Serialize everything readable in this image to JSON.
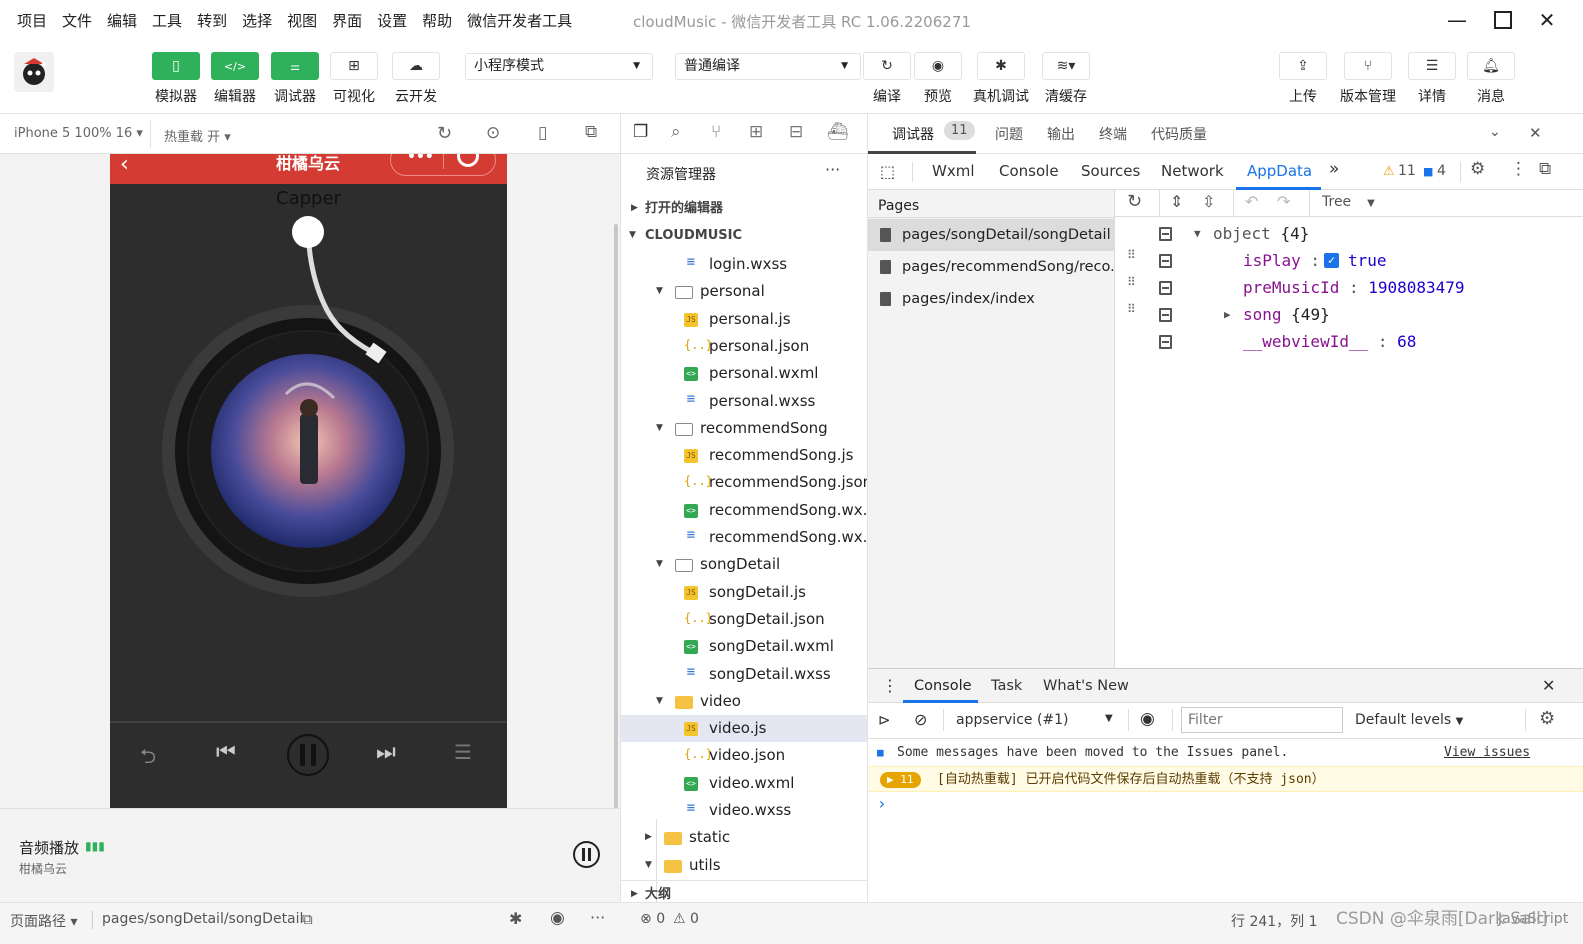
{
  "menu": [
    "项目",
    "文件",
    "编辑",
    "工具",
    "转到",
    "选择",
    "视图",
    "界面",
    "设置",
    "帮助",
    "微信开发者工具"
  ],
  "window_title": "cloudMusic - 微信开发者工具 RC 1.06.2206271",
  "toolbar": {
    "simulator": "模拟器",
    "editor": "编辑器",
    "debugger": "调试器",
    "visual": "可视化",
    "cloud": "云开发",
    "mode_select": "小程序模式",
    "compile_select": "普通编译",
    "compile": "编译",
    "preview": "预览",
    "real_debug": "真机调试",
    "clear_cache": "清缓存",
    "upload": "上传",
    "version": "版本管理",
    "details": "详情",
    "messages": "消息"
  },
  "simbar": {
    "device": "iPhone 5 100% 16",
    "hot_reload": "热重载 开"
  },
  "phone": {
    "nav_title": "柑橘乌云",
    "artist": "Capper"
  },
  "bgm": {
    "title": "音频播放",
    "subtitle": "柑橘乌云"
  },
  "statusL": {
    "path_label": "页面路径",
    "path": "pages/songDetail/songDetail"
  },
  "explorer": {
    "title": "资源管理器",
    "open_editors": "打开的编辑器",
    "project": "CLOUDMUSIC",
    "outline": "大纲",
    "files": [
      {
        "name": "login.wxss",
        "type": "wxss",
        "depth": 2
      },
      {
        "name": "personal",
        "type": "folder",
        "depth": 1,
        "open": true
      },
      {
        "name": "personal.js",
        "type": "js",
        "depth": 2
      },
      {
        "name": "personal.json",
        "type": "json",
        "depth": 2
      },
      {
        "name": "personal.wxml",
        "type": "wxml",
        "depth": 2
      },
      {
        "name": "personal.wxss",
        "type": "wxss",
        "depth": 2
      },
      {
        "name": "recommendSong",
        "type": "folder",
        "depth": 1,
        "open": true
      },
      {
        "name": "recommendSong.js",
        "type": "js",
        "depth": 2
      },
      {
        "name": "recommendSong.json",
        "type": "json",
        "depth": 2
      },
      {
        "name": "recommendSong.wx...",
        "type": "wxml",
        "depth": 2
      },
      {
        "name": "recommendSong.wx...",
        "type": "wxss",
        "depth": 2
      },
      {
        "name": "songDetail",
        "type": "folder",
        "depth": 1,
        "open": true
      },
      {
        "name": "songDetail.js",
        "type": "js",
        "depth": 2
      },
      {
        "name": "songDetail.json",
        "type": "json",
        "depth": 2
      },
      {
        "name": "songDetail.wxml",
        "type": "wxml",
        "depth": 2
      },
      {
        "name": "songDetail.wxss",
        "type": "wxss",
        "depth": 2
      },
      {
        "name": "video",
        "type": "folderY",
        "depth": 1,
        "open": true
      },
      {
        "name": "video.js",
        "type": "js",
        "depth": 2,
        "selected": true
      },
      {
        "name": "video.json",
        "type": "json",
        "depth": 2
      },
      {
        "name": "video.wxml",
        "type": "wxml",
        "depth": 2
      },
      {
        "name": "video.wxss",
        "type": "wxss",
        "depth": 2
      },
      {
        "name": "static",
        "type": "folderY",
        "depth": 0,
        "open": false
      },
      {
        "name": "utils",
        "type": "folderY",
        "depth": 0,
        "open": true
      }
    ]
  },
  "debug_tabs": {
    "debugger": "调试器",
    "badge": "11",
    "issues": "问题",
    "output": "输出",
    "terminal": "终端",
    "quality": "代码质量"
  },
  "dev_tabs": {
    "wxml": "Wxml",
    "console": "Console",
    "sources": "Sources",
    "network": "Network",
    "appdata": "AppData",
    "warn_count": "11",
    "info_count": "4"
  },
  "appdata": {
    "pages_label": "Pages",
    "view_mode": "Tree",
    "pages": [
      "pages/songDetail/songDetail",
      "pages/recommendSong/reco...",
      "pages/index/index"
    ],
    "root_label": "object",
    "root_count": "{4}",
    "rows": [
      {
        "key": "isPlay",
        "value": "true"
      },
      {
        "key": "preMusicId",
        "value": "1908083479"
      },
      {
        "key": "song",
        "value": "{49}"
      },
      {
        "key": "__webviewId__",
        "value": "68"
      }
    ]
  },
  "console": {
    "tab_console": "Console",
    "tab_task": "Task",
    "tab_whatsnew": "What's New",
    "context": "appservice (#1)",
    "filter_placeholder": "Filter",
    "levels": "Default levels",
    "msg_info": "Some messages have been moved to the Issues panel.",
    "view_issues": "View issues",
    "warn_count": "11",
    "msg_warn": "[自动热重载] 已开启代码文件保存后自动热重载（不支持 json）",
    "prompt": "›"
  },
  "statusR": {
    "errors": "0",
    "warnings": "0",
    "position": "行 241，列 1",
    "watermark": "CSDN @伞泉雨[Dark Sail]",
    "lang": "JavaScript"
  }
}
